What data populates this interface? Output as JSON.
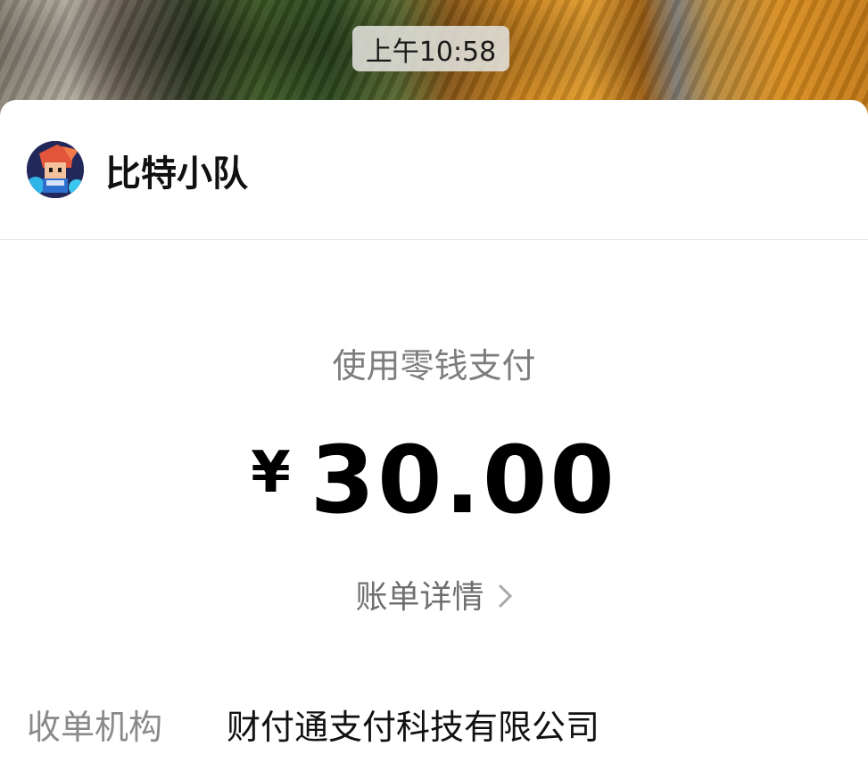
{
  "status": {
    "time": "上午10:58"
  },
  "merchant": {
    "name": "比特小队",
    "avatar_icon": "game-character-avatar"
  },
  "payment": {
    "method": "使用零钱支付",
    "currency_symbol": "¥",
    "amount": "30.00",
    "bill_detail_label": "账单详情"
  },
  "details": {
    "acquirer_label": "收单机构",
    "acquirer_value": "财付通支付科技有限公司"
  }
}
